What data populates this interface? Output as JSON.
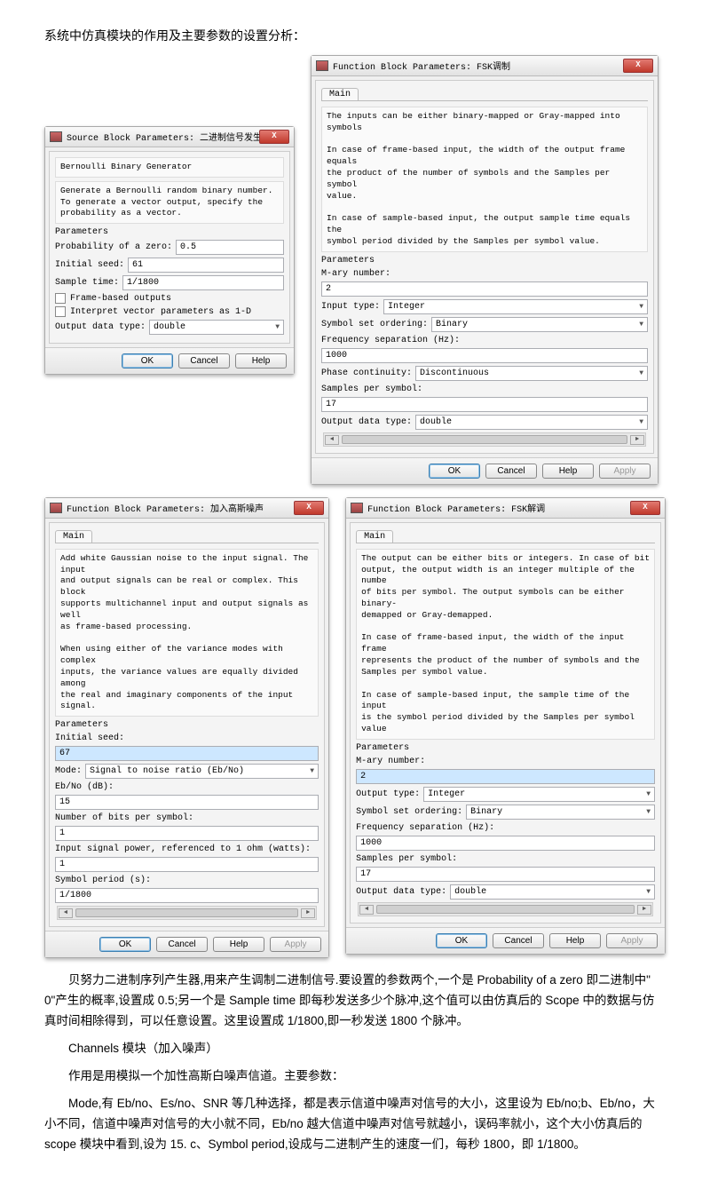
{
  "heading": "系统中仿真模块的作用及主要参数的设置分析：",
  "dlg1": {
    "title": "Source Block Parameters: 二进制信号发生器",
    "name": "Bernoulli Binary Generator",
    "desc": "Generate a Bernoulli random binary number.\nTo generate a vector output, specify the\nprobability as a vector.",
    "params_label": "Parameters",
    "prob_label": "Probability of a zero:",
    "prob_value": "0.5",
    "seed_label": "Initial seed:",
    "seed_value": "61",
    "st_label": "Sample time:",
    "st_value": "1/1800",
    "chk1": "Frame-based outputs",
    "chk2": "Interpret vector parameters as 1-D",
    "odt_label": "Output data type:",
    "odt_value": "double",
    "ok": "OK",
    "cancel": "Cancel",
    "help": "Help"
  },
  "dlg2": {
    "title": "Function Block Parameters: FSK调制",
    "desc": "The inputs can be either binary-mapped or Gray-mapped into symbols\n\nIn case of frame-based input, the width of the output frame equals\nthe product of the number of symbols and the Samples per symbol\nvalue.\n\nIn case of sample-based input, the output sample time equals the\nsymbol period divided by the Samples per symbol value.",
    "params_label": "Parameters",
    "mary_label": "M-ary number:",
    "mary_value": "2",
    "itype_label": "Input type:",
    "itype_value": "Integer",
    "sso_label": "Symbol set ordering:",
    "sso_value": "Binary",
    "fsep_label": "Frequency separation (Hz):",
    "fsep_value": "1000",
    "pcont_label": "Phase continuity:",
    "pcont_value": "Discontinuous",
    "sps_label": "Samples per symbol:",
    "sps_value": "17",
    "odt_label": "Output data type:",
    "odt_value": "double",
    "ok": "OK",
    "cancel": "Cancel",
    "help": "Help",
    "apply": "Apply"
  },
  "dlg3": {
    "title": "Function Block Parameters: 加入高斯噪声",
    "desc": "Add white Gaussian noise to the input signal. The input\nand output signals can be real or complex. This block\nsupports multichannel input and output signals as well\nas frame-based processing.\n\nWhen using either of the variance modes with complex\ninputs, the variance values are equally divided among\nthe real and imaginary components of the input signal.",
    "params_label": "Parameters",
    "seed_label": "Initial seed:",
    "seed_value": "67",
    "mode_label": "Mode:",
    "mode_value": "Signal to noise ratio  (Eb/No)",
    "ebno_label": "Eb/No (dB):",
    "ebno_value": "15",
    "nbps_label": "Number of bits per symbol:",
    "nbps_value": "1",
    "isp_label": "Input signal power, referenced to 1 ohm (watts):",
    "isp_value": "1",
    "sp_label": "Symbol period (s):",
    "sp_value": "1/1800",
    "ok": "OK",
    "cancel": "Cancel",
    "help": "Help",
    "apply": "Apply"
  },
  "dlg4": {
    "title": "Function Block Parameters: FSK解调",
    "desc": "The output can be either bits or integers. In case of bit\noutput, the output width is an integer multiple of the numbe\nof bits per symbol. The output symbols can be either binary-\ndemapped or Gray-demapped.\n\nIn case of frame-based input, the width of the input frame\nrepresents the product of the number of symbols and the\nSamples per symbol value.\n\nIn case of sample-based input, the sample time of the input\nis the symbol period divided by the Samples per symbol value",
    "params_label": "Parameters",
    "mary_label": "M-ary number:",
    "mary_value": "2",
    "otype_label": "Output type:",
    "otype_value": "Integer",
    "sso_label": "Symbol set ordering:",
    "sso_value": "Binary",
    "fsep_label": "Frequency separation (Hz):",
    "fsep_value": "1000",
    "sps_label": "Samples per symbol:",
    "sps_value": "17",
    "odt_label": "Output data type:",
    "odt_value": "double",
    "ok": "OK",
    "cancel": "Cancel",
    "help": "Help",
    "apply": "Apply"
  },
  "tab_main": "Main",
  "body": {
    "p1": "贝努力二进制序列产生器,用来产生调制二进制信号.要设置的参数两个,一个是 Probability of a zero 即二进制中\" 0\"产生的概率,设置成 0.5;另一个是 Sample time 即每秒发送多少个脉冲,这个值可以由仿真后的 Scope 中的数据与仿真时间相除得到，可以任意设置。这里设置成 1/1800,即一秒发送 1800 个脉冲。",
    "p2": "Channels 模块（加入噪声）",
    "p3": "作用是用模拟一个加性高斯白噪声信道。主要参数：",
    "p4": "Mode,有 Eb/no、Es/no、SNR 等几种选择，都是表示信道中噪声对信号的大小，这里设为 Eb/no;b、Eb/no，大小不同，信道中噪声对信号的大小就不同，Eb/no 越大信道中噪声对信号就越小，误码率就小，这个大小仿真后的 scope 模块中看到,设为 15. c、Symbol period,设成与二进制产生的速度一们，每秒 1800，即 1/1800。"
  }
}
